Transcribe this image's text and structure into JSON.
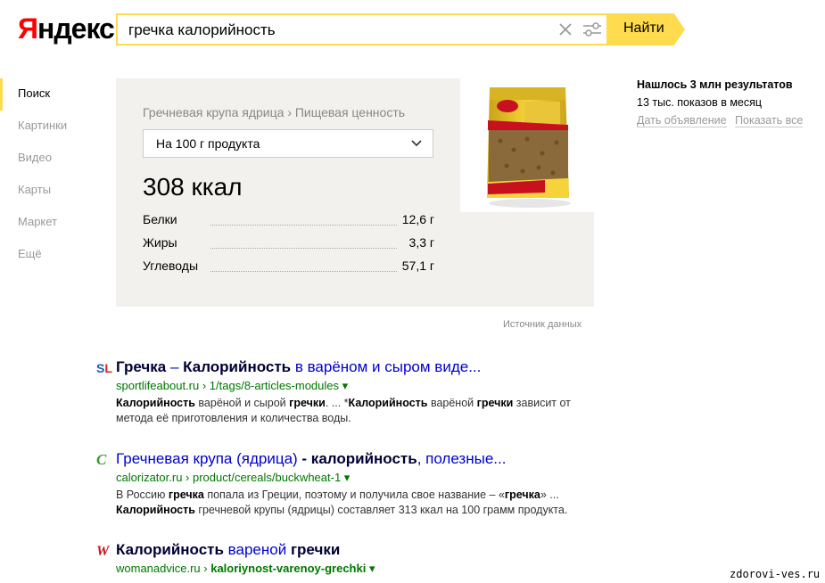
{
  "logo": {
    "first_letter": "Я",
    "rest": "ндекс"
  },
  "search": {
    "query": "гречка калорийность",
    "button_label": "Найти"
  },
  "nav": {
    "items": [
      "Поиск",
      "Картинки",
      "Видео",
      "Карты",
      "Маркет",
      "Ещё"
    ]
  },
  "card": {
    "breadcrumb": "Гречневая крупа ядрица › Пищевая ценность",
    "portion": "На 100 г продукта",
    "kcal": "308 ккал",
    "nutrients": [
      {
        "name": "Белки",
        "value": "12,6 г"
      },
      {
        "name": "Жиры",
        "value": "3,3 г"
      },
      {
        "name": "Углеводы",
        "value": "57,1 г"
      }
    ],
    "source": "Источник данных"
  },
  "right": {
    "found": "Нашлось 3 млн результатов",
    "shows": "13 тыс. показов в месяц",
    "link1": "Дать объявление",
    "link2": "Показать все"
  },
  "results": [
    {
      "favicon": "SL",
      "title_a": "Гречка",
      "title_b": " – ",
      "title_c": "Калорийность",
      "title_d": " в варёном и сыром виде...",
      "url_domain": "sportlifeabout.ru",
      "url_path": " › 1/tags/8-articles-modules ▾",
      "snip_1b": "Калорийность",
      "snip_1": " варёной и сырой ",
      "snip_2b": "гречки",
      "snip_2": ". ... *",
      "snip_3b": "Калорийность",
      "snip_3": " варёной ",
      "snip_4b": "гречки",
      "snip_4": " зависит от метода её приготовления и количества воды."
    },
    {
      "favicon": "C",
      "title_a": "Гречневая крупа (ядрица) ",
      "title_b": "- калорийность",
      "title_c": ", полезные...",
      "url_domain": "calorizator.ru",
      "url_path": " › product/cereals/buckwheat-1 ▾",
      "snip_1": "В Россию ",
      "snip_2b": "гречка",
      "snip_2": " попала из Греции, поэтому и получила свое название – «",
      "snip_3b": "гречка",
      "snip_3": "» ...",
      "snip_4b": "Калорийность",
      "snip_4": " гречневой крупы (ядрицы) составляет 313 ккал на 100 грамм продукта."
    },
    {
      "favicon": "W",
      "title_a": "Калорийность",
      "title_b": " вареной ",
      "title_c": "гречки",
      "url_domain": "womanadvice.ru",
      "url_path_sep": " › ",
      "url_path_b": "kaloriynost-varenoy-grechki",
      "url_path_end": " ▾"
    }
  ],
  "watermark": "zdorovi-ves.ru",
  "colors": {
    "accent": "#ffdb4d",
    "link": "#0000cc",
    "url": "#007700"
  }
}
